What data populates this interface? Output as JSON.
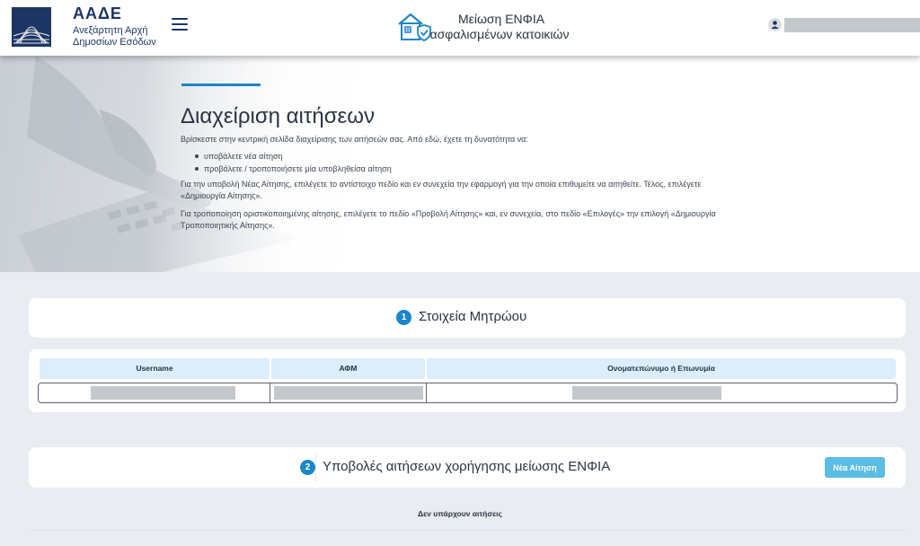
{
  "header": {
    "org_abbr": "ΑΑΔΕ",
    "org_name_line1": "Ανεξάρτητη Αρχή",
    "org_name_line2": "Δημοσίων Εσόδων",
    "app_title_line1": "Μείωση ΕΝΦΙΑ",
    "app_title_line2": "ασφαλισμένων κατοικιών",
    "icons": {
      "menu": "hamburger-icon",
      "app": "house-shield-icon",
      "user": "user-icon"
    },
    "brand_color": "#1d3563"
  },
  "hero": {
    "title": "Διαχείριση αιτήσεων",
    "intro": "Βρίσκεστε στην κεντρική σελίδα διαχείρισης των αιτήσεών σας. Από εδώ, έχετε τη δυνατότητα να:",
    "options": [
      "υποβάλετε νέα αίτηση",
      "προβάλετε / τροποποιήσετε μία υποβληθείσα αίτηση"
    ],
    "paragraph_new": "Για την υποβολή Νέας Αίτησης, επιλέγετε το αντίστοιχο πεδίο και εν συνεχεία την εφαρμογή για την οποία επιθυμείτε να αιτηθείτε. Τέλος, επιλέγετε «Δημιουργία Αίτησης».",
    "paragraph_modify": "Για τροποποίηση οριστικοποιημένης αίτησης, επιλέγετε το πεδίο «Προβολή Αίτησης» και, εν συνεχεία, στο πεδίο «Επιλογές» την επιλογή «Δημιουργία Τροποποιητικής Αίτησης».",
    "accent_color": "#1c86c8"
  },
  "section1": {
    "step": "1",
    "title": "Στοιχεία Μητρώου"
  },
  "registry_table": {
    "columns": [
      "Username",
      "ΑΦΜ",
      "Ονοματεπώνυμο ή Επωνυμία"
    ],
    "header_bg": "#dcedfb"
  },
  "section2": {
    "step": "2",
    "title": "Υποβολές αιτήσεων χορήγησης μείωσης ΕΝΦΙΑ",
    "new_button_label": "Νέα Αίτηση",
    "new_button_color": "#5bbde3",
    "empty_message": "Δεν υπάρχουν αιτήσεις"
  }
}
